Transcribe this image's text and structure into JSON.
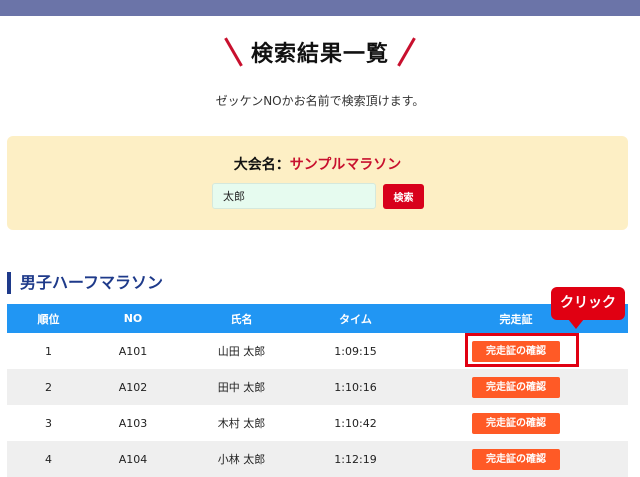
{
  "page": {
    "title": "検索結果一覧",
    "subtitle": "ゼッケンNOかお名前で検索頂けます。"
  },
  "search": {
    "event_label": "大会名：",
    "event_name": "サンプルマラソン",
    "name_value": "太郎",
    "button_label": "検索"
  },
  "section": {
    "title": "男子ハーフマラソン"
  },
  "table": {
    "headers": [
      "順位",
      "NO",
      "氏名",
      "タイム",
      "完走証"
    ],
    "rows": [
      {
        "rank": "1",
        "no": "A101",
        "name": "山田 太郎",
        "time": "1:09:15",
        "cert": "完走証の確認"
      },
      {
        "rank": "2",
        "no": "A102",
        "name": "田中 太郎",
        "time": "1:10:16",
        "cert": "完走証の確認"
      },
      {
        "rank": "3",
        "no": "A103",
        "name": "木村 太郎",
        "time": "1:10:42",
        "cert": "完走証の確認"
      },
      {
        "rank": "4",
        "no": "A104",
        "name": "小林 太郎",
        "time": "1:12:19",
        "cert": "完走証の確認"
      }
    ]
  },
  "annotation": {
    "callout_text": "クリック",
    "color": "#e00012"
  },
  "colors": {
    "header_bar": "#6b74a8",
    "accent_red": "#c8102e",
    "table_header": "#2196f3",
    "cert_button": "#ff5a26",
    "search_panel": "#fdefc5"
  }
}
